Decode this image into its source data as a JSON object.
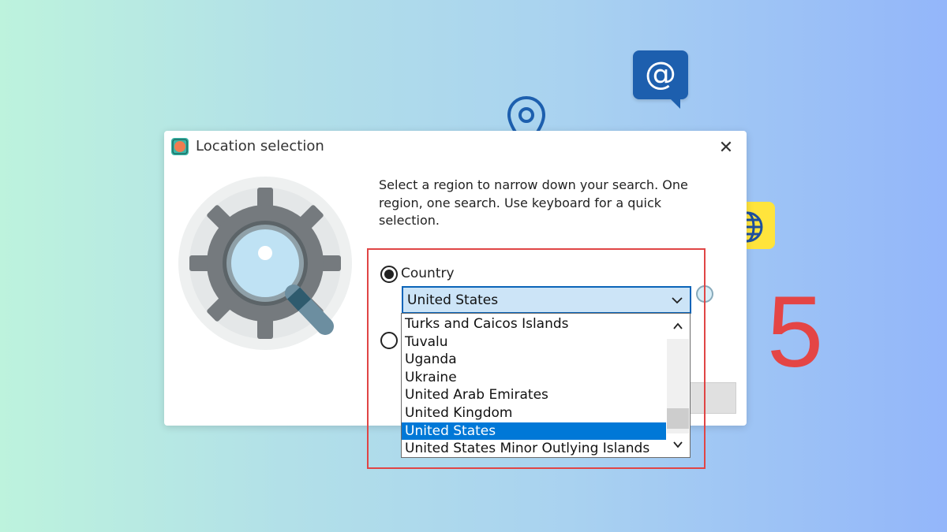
{
  "dialog": {
    "title": "Location selection",
    "close_label": "✕",
    "description": "Select a region to narrow down your search. One region, one search. Use keyboard for a quick selection.",
    "country_label": "Country",
    "country_selected": true,
    "combo_value": "United States"
  },
  "dropdown": {
    "options": [
      "Turks and Caicos Islands",
      "Tuvalu",
      "Uganda",
      "Ukraine",
      "United Arab Emirates",
      "United Kingdom",
      "United States",
      "United States Minor Outlying Islands"
    ],
    "selected_index": 6
  },
  "decorations": {
    "step_number": "5",
    "at_symbol": "@",
    "accent_red": "#e04545",
    "selection_blue": "#0078d7"
  }
}
